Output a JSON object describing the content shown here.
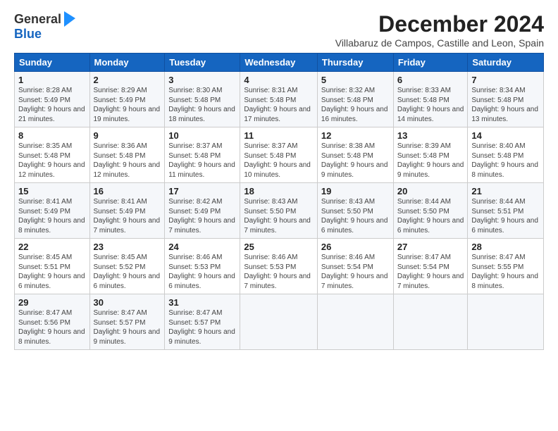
{
  "logo": {
    "general": "General",
    "blue": "Blue"
  },
  "title": "December 2024",
  "subtitle": "Villabaruz de Campos, Castille and Leon, Spain",
  "days_of_week": [
    "Sunday",
    "Monday",
    "Tuesday",
    "Wednesday",
    "Thursday",
    "Friday",
    "Saturday"
  ],
  "weeks": [
    [
      {
        "day": "1",
        "sunrise": "8:28 AM",
        "sunset": "5:49 PM",
        "daylight": "9 hours and 21 minutes."
      },
      {
        "day": "2",
        "sunrise": "8:29 AM",
        "sunset": "5:49 PM",
        "daylight": "9 hours and 19 minutes."
      },
      {
        "day": "3",
        "sunrise": "8:30 AM",
        "sunset": "5:48 PM",
        "daylight": "9 hours and 18 minutes."
      },
      {
        "day": "4",
        "sunrise": "8:31 AM",
        "sunset": "5:48 PM",
        "daylight": "9 hours and 17 minutes."
      },
      {
        "day": "5",
        "sunrise": "8:32 AM",
        "sunset": "5:48 PM",
        "daylight": "9 hours and 16 minutes."
      },
      {
        "day": "6",
        "sunrise": "8:33 AM",
        "sunset": "5:48 PM",
        "daylight": "9 hours and 14 minutes."
      },
      {
        "day": "7",
        "sunrise": "8:34 AM",
        "sunset": "5:48 PM",
        "daylight": "9 hours and 13 minutes."
      }
    ],
    [
      {
        "day": "8",
        "sunrise": "8:35 AM",
        "sunset": "5:48 PM",
        "daylight": "9 hours and 12 minutes."
      },
      {
        "day": "9",
        "sunrise": "8:36 AM",
        "sunset": "5:48 PM",
        "daylight": "9 hours and 12 minutes."
      },
      {
        "day": "10",
        "sunrise": "8:37 AM",
        "sunset": "5:48 PM",
        "daylight": "9 hours and 11 minutes."
      },
      {
        "day": "11",
        "sunrise": "8:37 AM",
        "sunset": "5:48 PM",
        "daylight": "9 hours and 10 minutes."
      },
      {
        "day": "12",
        "sunrise": "8:38 AM",
        "sunset": "5:48 PM",
        "daylight": "9 hours and 9 minutes."
      },
      {
        "day": "13",
        "sunrise": "8:39 AM",
        "sunset": "5:48 PM",
        "daylight": "9 hours and 9 minutes."
      },
      {
        "day": "14",
        "sunrise": "8:40 AM",
        "sunset": "5:48 PM",
        "daylight": "9 hours and 8 minutes."
      }
    ],
    [
      {
        "day": "15",
        "sunrise": "8:41 AM",
        "sunset": "5:49 PM",
        "daylight": "9 hours and 8 minutes."
      },
      {
        "day": "16",
        "sunrise": "8:41 AM",
        "sunset": "5:49 PM",
        "daylight": "9 hours and 7 minutes."
      },
      {
        "day": "17",
        "sunrise": "8:42 AM",
        "sunset": "5:49 PM",
        "daylight": "9 hours and 7 minutes."
      },
      {
        "day": "18",
        "sunrise": "8:43 AM",
        "sunset": "5:50 PM",
        "daylight": "9 hours and 7 minutes."
      },
      {
        "day": "19",
        "sunrise": "8:43 AM",
        "sunset": "5:50 PM",
        "daylight": "9 hours and 6 minutes."
      },
      {
        "day": "20",
        "sunrise": "8:44 AM",
        "sunset": "5:50 PM",
        "daylight": "9 hours and 6 minutes."
      },
      {
        "day": "21",
        "sunrise": "8:44 AM",
        "sunset": "5:51 PM",
        "daylight": "9 hours and 6 minutes."
      }
    ],
    [
      {
        "day": "22",
        "sunrise": "8:45 AM",
        "sunset": "5:51 PM",
        "daylight": "9 hours and 6 minutes."
      },
      {
        "day": "23",
        "sunrise": "8:45 AM",
        "sunset": "5:52 PM",
        "daylight": "9 hours and 6 minutes."
      },
      {
        "day": "24",
        "sunrise": "8:46 AM",
        "sunset": "5:53 PM",
        "daylight": "9 hours and 6 minutes."
      },
      {
        "day": "25",
        "sunrise": "8:46 AM",
        "sunset": "5:53 PM",
        "daylight": "9 hours and 7 minutes."
      },
      {
        "day": "26",
        "sunrise": "8:46 AM",
        "sunset": "5:54 PM",
        "daylight": "9 hours and 7 minutes."
      },
      {
        "day": "27",
        "sunrise": "8:47 AM",
        "sunset": "5:54 PM",
        "daylight": "9 hours and 7 minutes."
      },
      {
        "day": "28",
        "sunrise": "8:47 AM",
        "sunset": "5:55 PM",
        "daylight": "9 hours and 8 minutes."
      }
    ],
    [
      {
        "day": "29",
        "sunrise": "8:47 AM",
        "sunset": "5:56 PM",
        "daylight": "9 hours and 8 minutes."
      },
      {
        "day": "30",
        "sunrise": "8:47 AM",
        "sunset": "5:57 PM",
        "daylight": "9 hours and 9 minutes."
      },
      {
        "day": "31",
        "sunrise": "8:47 AM",
        "sunset": "5:57 PM",
        "daylight": "9 hours and 9 minutes."
      },
      null,
      null,
      null,
      null
    ]
  ],
  "labels": {
    "sunrise": "Sunrise:",
    "sunset": "Sunset:",
    "daylight": "Daylight:"
  }
}
